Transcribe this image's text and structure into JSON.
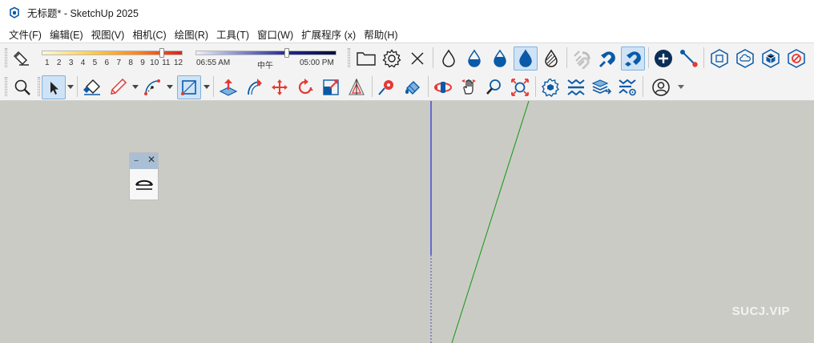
{
  "window": {
    "title": "无标题* - SketchUp 2025"
  },
  "menu": [
    "文件(F)",
    "编辑(E)",
    "视图(V)",
    "相机(C)",
    "绘图(R)",
    "工具(T)",
    "窗口(W)",
    "扩展程序 (x)",
    "帮助(H)"
  ],
  "shadows": {
    "month_ticks": [
      "1",
      "2",
      "3",
      "4",
      "5",
      "6",
      "7",
      "8",
      "9",
      "10",
      "11",
      "12"
    ],
    "time_start": "06:55 AM",
    "time_mid": "中午",
    "time_end": "05:00 PM",
    "month_value_fraction": 0.85,
    "time_value_fraction": 0.65
  },
  "viewport": {
    "background": "#cbcbc6",
    "watermark": "SUCJ.VIP"
  },
  "mini_window": {
    "dots": "..."
  },
  "colors": {
    "axis_blue": "#1e2bd0",
    "axis_green": "#1e9e1e",
    "toolbar_blue": "#0a5aa8",
    "toolbar_red": "#e53935",
    "selected_bg": "#cfe3f6"
  }
}
